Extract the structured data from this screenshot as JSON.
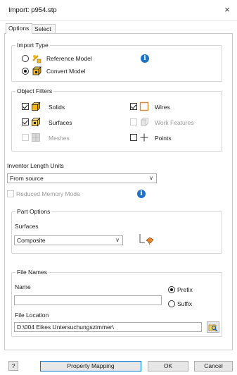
{
  "window": {
    "title": "Import: p954.stp",
    "close_glyph": "×"
  },
  "tabs": [
    {
      "label": "Options",
      "active": true
    },
    {
      "label": "Select",
      "active": false
    }
  ],
  "import_type": {
    "title": "Import Type",
    "options": [
      {
        "label": "Reference Model",
        "selected": false,
        "icon": "reference-model-icon"
      },
      {
        "label": "Convert Model",
        "selected": true,
        "icon": "convert-model-icon"
      }
    ],
    "info_glyph": "i"
  },
  "object_filters": {
    "title": "Object Filters",
    "items": [
      {
        "label": "Solids",
        "checked": true,
        "enabled": true,
        "icon": "solids-cube-icon"
      },
      {
        "label": "Wires",
        "checked": true,
        "enabled": true,
        "icon": "wires-square-icon"
      },
      {
        "label": "Surfaces",
        "checked": true,
        "enabled": true,
        "icon": "surfaces-icon"
      },
      {
        "label": "Work Features",
        "checked": false,
        "enabled": false,
        "icon": "work-features-icon"
      },
      {
        "label": "Meshes",
        "checked": false,
        "enabled": false,
        "icon": "meshes-icon"
      },
      {
        "label": "Points",
        "checked": false,
        "enabled": true,
        "icon": "points-crosshair-icon"
      }
    ]
  },
  "units": {
    "label": "Inventor Length Units",
    "value": "From source"
  },
  "reduced_memory": {
    "label": "Reduced Memory Mode",
    "checked": false,
    "enabled": false
  },
  "part_options": {
    "title": "Part Options",
    "surfaces_label": "Surfaces",
    "surfaces_value": "Composite"
  },
  "file_names": {
    "title": "File Names",
    "name_label": "Name",
    "name_value": "",
    "prefix_label": "Prefix",
    "suffix_label": "Suffix",
    "prefix_selected": true,
    "location_label": "File Location",
    "location_value": "D:\\004 Eikes Untersuchungszimmer\\"
  },
  "footer": {
    "help_glyph": "?",
    "property_mapping_label": "Property Mapping",
    "ok_label": "OK",
    "cancel_label": "Cancel"
  },
  "colors": {
    "accent": "#0078d7",
    "info_blue": "#1e73c8",
    "cube_yellow": "#f2b51c",
    "wire_orange": "#e8852a"
  }
}
